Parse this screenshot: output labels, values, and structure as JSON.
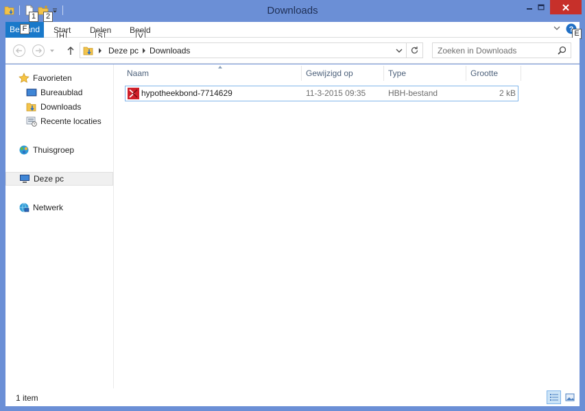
{
  "window": {
    "title": "Downloads"
  },
  "keytips": {
    "qat1": "1",
    "qat2": "2",
    "file": "F",
    "start": "H",
    "share": "S",
    "view": "V",
    "help": "E"
  },
  "ribbon": {
    "file_label": "Bestand",
    "tabs": [
      "Start",
      "Delen",
      "Beeld"
    ]
  },
  "address": {
    "crumbs": [
      "Deze pc",
      "Downloads"
    ]
  },
  "search": {
    "placeholder": "Zoeken in Downloads"
  },
  "navpane": {
    "favorites": "Favorieten",
    "fav_items": [
      "Bureaublad",
      "Downloads",
      "Recente locaties"
    ],
    "homegroup": "Thuisgroep",
    "thispc": "Deze pc",
    "network": "Netwerk"
  },
  "columns": [
    "Naam",
    "Gewijzigd op",
    "Type",
    "Grootte"
  ],
  "files": [
    {
      "name": "hypotheekbond-7714629",
      "modified": "11-3-2015 09:35",
      "type": "HBH-bestand",
      "size": "2 kB"
    }
  ],
  "status": {
    "count": "1 item"
  },
  "colors": {
    "titlebar": "#6b8fd6",
    "file_tab": "#1979ca",
    "close": "#c7302a",
    "selection_border": "#7eb4ea"
  },
  "icons": [
    "folder-download-icon",
    "new-document-icon",
    "new-folder-icon",
    "customize-qat-icon",
    "minimize-icon",
    "maximize-icon",
    "close-icon",
    "expand-ribbon-icon",
    "help-icon",
    "back-icon",
    "forward-icon",
    "recent-dropdown-icon",
    "up-icon",
    "refresh-icon",
    "search-icon",
    "star-icon",
    "desktop-icon",
    "downloads-folder-icon",
    "recent-places-icon",
    "homegroup-icon",
    "computer-icon",
    "network-icon",
    "hbh-file-icon",
    "details-view-icon",
    "large-icons-view-icon"
  ]
}
